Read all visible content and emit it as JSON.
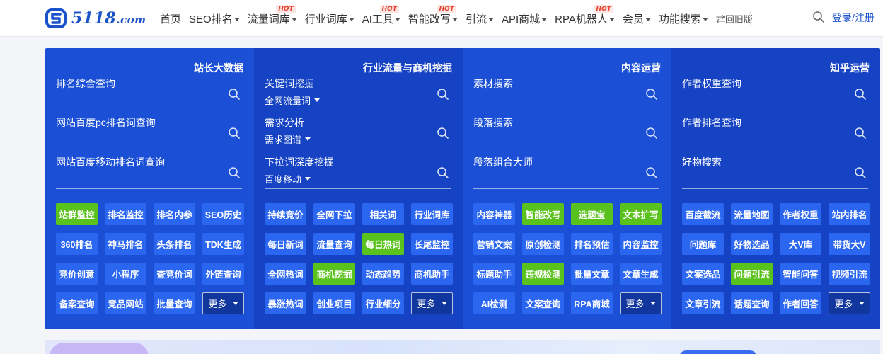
{
  "brand": {
    "name": "5118",
    "suffix": ".com",
    "color": "#1a52c9"
  },
  "nav": {
    "items": [
      {
        "label": "首页",
        "has_caret": false,
        "hot": false
      },
      {
        "label": "SEO排名",
        "has_caret": true,
        "hot": false
      },
      {
        "label": "流量词库",
        "has_caret": true,
        "hot": true
      },
      {
        "label": "行业词库",
        "has_caret": true,
        "hot": false
      },
      {
        "label": "AI工具",
        "has_caret": true,
        "hot": true
      },
      {
        "label": "智能改写",
        "has_caret": true,
        "hot": true
      },
      {
        "label": "引流",
        "has_caret": true,
        "hot": false
      },
      {
        "label": "API商城",
        "has_caret": true,
        "hot": false
      },
      {
        "label": "RPA机器人",
        "has_caret": true,
        "hot": true
      },
      {
        "label": "会员",
        "has_caret": true,
        "hot": false
      },
      {
        "label": "功能搜索",
        "has_caret": true,
        "hot": false
      }
    ],
    "hot_label": "HOT",
    "back_label": "⇄回旧版",
    "search_icon": "search-icon",
    "login_label": "登录/注册"
  },
  "panel": {
    "columns": [
      {
        "title": "站长大数据",
        "fields": [
          {
            "label": "排名综合查询",
            "sub": ""
          },
          {
            "label": "网站百度pc排名词查询",
            "sub": ""
          },
          {
            "label": "网站百度移动排名词查询",
            "sub": ""
          }
        ],
        "tags": [
          {
            "label": "站群监控",
            "green": true
          },
          {
            "label": "排名监控",
            "green": false
          },
          {
            "label": "排名内参",
            "green": false
          },
          {
            "label": "SEO历史",
            "green": false
          },
          {
            "label": "360排名",
            "green": false
          },
          {
            "label": "神马排名",
            "green": false
          },
          {
            "label": "头条排名",
            "green": false
          },
          {
            "label": "TDK生成",
            "green": false
          },
          {
            "label": "竞价创意",
            "green": false
          },
          {
            "label": "小程序",
            "green": false
          },
          {
            "label": "查竞价词",
            "green": false
          },
          {
            "label": "外链查询",
            "green": false
          },
          {
            "label": "备案查询",
            "green": false
          },
          {
            "label": "竞品网站",
            "green": false
          },
          {
            "label": "批量查询",
            "green": false
          }
        ],
        "more_label": "更多"
      },
      {
        "title": "行业流量与商机挖掘",
        "fields": [
          {
            "label": "关键词挖掘",
            "sub": "全网流量词"
          },
          {
            "label": "需求分析",
            "sub": "需求图谱"
          },
          {
            "label": "下拉词深度挖掘",
            "sub": "百度移动"
          }
        ],
        "tags": [
          {
            "label": "持续竞价",
            "green": false
          },
          {
            "label": "全网下拉",
            "green": false
          },
          {
            "label": "相关词",
            "green": false
          },
          {
            "label": "行业词库",
            "green": false
          },
          {
            "label": "每日新词",
            "green": false
          },
          {
            "label": "流量查询",
            "green": false
          },
          {
            "label": "每日热词",
            "green": true
          },
          {
            "label": "长尾监控",
            "green": false
          },
          {
            "label": "全网热词",
            "green": false
          },
          {
            "label": "商机挖掘",
            "green": true
          },
          {
            "label": "动态趋势",
            "green": false
          },
          {
            "label": "商机助手",
            "green": false
          },
          {
            "label": "暴涨热词",
            "green": false
          },
          {
            "label": "创业项目",
            "green": false
          },
          {
            "label": "行业细分",
            "green": false
          }
        ],
        "more_label": "更多"
      },
      {
        "title": "内容运营",
        "fields": [
          {
            "label": "素材搜索",
            "sub": ""
          },
          {
            "label": "段落搜索",
            "sub": ""
          },
          {
            "label": "段落组合大师",
            "sub": ""
          }
        ],
        "tags": [
          {
            "label": "内容神器",
            "green": false
          },
          {
            "label": "智能改写",
            "green": true
          },
          {
            "label": "选题宝",
            "green": true
          },
          {
            "label": "文本扩写",
            "green": true
          },
          {
            "label": "营销文案",
            "green": false
          },
          {
            "label": "原创检测",
            "green": false
          },
          {
            "label": "排名预估",
            "green": false
          },
          {
            "label": "内容监控",
            "green": false
          },
          {
            "label": "标题助手",
            "green": false
          },
          {
            "label": "违规检测",
            "green": true
          },
          {
            "label": "批量文章",
            "green": false
          },
          {
            "label": "文章生成",
            "green": false
          },
          {
            "label": "AI检测",
            "green": false
          },
          {
            "label": "文案查询",
            "green": false
          },
          {
            "label": "RPA商城",
            "green": false
          }
        ],
        "more_label": "更多"
      },
      {
        "title": "知乎运营",
        "fields": [
          {
            "label": "作者权重查询",
            "sub": ""
          },
          {
            "label": "作者排名查询",
            "sub": ""
          },
          {
            "label": "好物搜索",
            "sub": ""
          }
        ],
        "tags": [
          {
            "label": "百度截流",
            "green": false
          },
          {
            "label": "流量地图",
            "green": false
          },
          {
            "label": "作者权重",
            "green": false
          },
          {
            "label": "站内排名",
            "green": false
          },
          {
            "label": "问题库",
            "green": false
          },
          {
            "label": "好物选品",
            "green": false
          },
          {
            "label": "大V库",
            "green": false
          },
          {
            "label": "带货大V",
            "green": false
          },
          {
            "label": "文案选品",
            "green": false
          },
          {
            "label": "问题引流",
            "green": true
          },
          {
            "label": "智能问答",
            "green": false
          },
          {
            "label": "视频引流",
            "green": false
          },
          {
            "label": "文章引流",
            "green": false
          },
          {
            "label": "话题查询",
            "green": false
          },
          {
            "label": "作者回答",
            "green": false
          }
        ],
        "more_label": "更多"
      }
    ]
  },
  "colors": {
    "panel_light": "#1a4fd6",
    "panel_dark": "#1643c4",
    "tag_blue": "#2a66f0",
    "tag_green": "#5ac21d",
    "hot": "#e6402c"
  }
}
